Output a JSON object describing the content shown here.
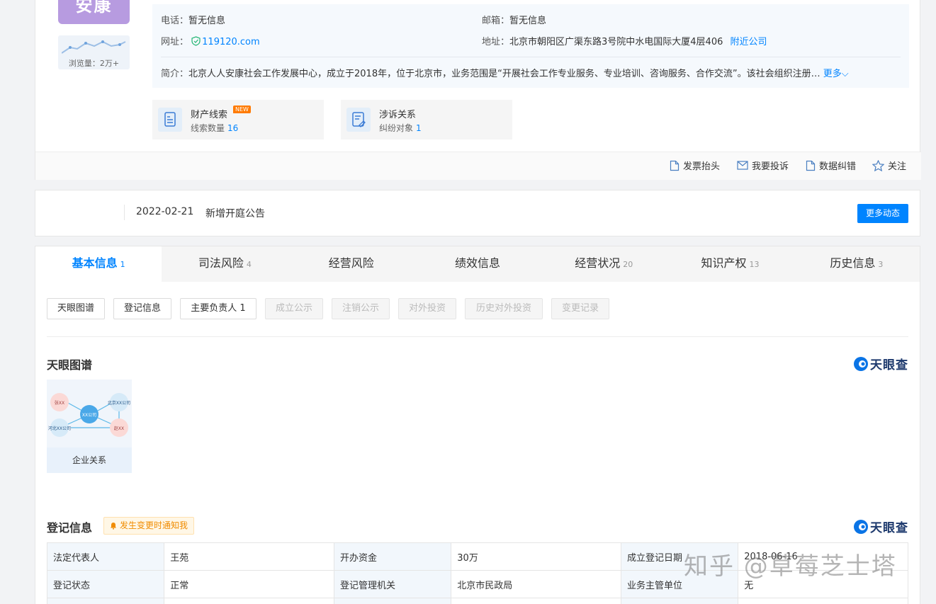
{
  "company": {
    "logo_text": "安康",
    "views_label": "浏览量：2万+"
  },
  "contact": {
    "phone_label": "电话：",
    "phone_value": "暂无信息",
    "email_label": "邮箱：",
    "email_value": "暂无信息",
    "website_label": "网址：",
    "website_value": "119120.com",
    "address_label": "地址：",
    "address_value": "北京市朝阳区广渠东路3号院中水电国际大厦4层406",
    "nearby_link": "附近公司",
    "intro_label": "简介：",
    "intro_value": "北京人人安康社会工作发展中心，成立于2018年，位于北京市，业务范围是“开展社会工作专业服务、专业培训、咨询服务、合作交流”。该社会组织注册…",
    "more_link": "更多"
  },
  "clues": [
    {
      "title": "财产线索",
      "badge": "NEW",
      "sub_label": "线索数量",
      "count": "16"
    },
    {
      "title": "涉诉关系",
      "sub_label": "纠纷对象",
      "count": "1"
    }
  ],
  "actions": {
    "invoice": "发票抬头",
    "complain": "我要投诉",
    "correct": "数据纠错",
    "follow": "关注"
  },
  "news": {
    "date": "2022-02-21",
    "text": "新增开庭公告",
    "more_button": "更多动态"
  },
  "tabs": [
    {
      "label": "基本信息",
      "count": "1"
    },
    {
      "label": "司法风险",
      "count": "4"
    },
    {
      "label": "经营风险",
      "count": ""
    },
    {
      "label": "绩效信息",
      "count": ""
    },
    {
      "label": "经营状况",
      "count": "20"
    },
    {
      "label": "知识产权",
      "count": "13"
    },
    {
      "label": "历史信息",
      "count": "3"
    }
  ],
  "chips": [
    {
      "label": "天眼图谱",
      "enabled": true
    },
    {
      "label": "登记信息",
      "enabled": true
    },
    {
      "label": "主要负责人 1",
      "enabled": true
    },
    {
      "label": "成立公示",
      "enabled": false
    },
    {
      "label": "注销公示",
      "enabled": false
    },
    {
      "label": "对外投资",
      "enabled": false
    },
    {
      "label": "历史对外投资",
      "enabled": false
    },
    {
      "label": "变更记录",
      "enabled": false
    }
  ],
  "graph_section": {
    "title": "天眼图谱",
    "brand": "天眼查",
    "card_label": "企业关系",
    "nodes": {
      "center": "XX公司",
      "a": "张XX",
      "b": "北京XX公司",
      "c": "河北XX公司",
      "d": "赵XX"
    }
  },
  "registration": {
    "title": "登记信息",
    "notify": "发生变更时通知我",
    "brand": "天眼查",
    "rows": [
      [
        "法定代表人",
        "王苑",
        "开办资金",
        "30万",
        "成立登记日期",
        "2018-06-16"
      ],
      [
        "登记状态",
        "正常",
        "登记管理机关",
        "北京市民政局",
        "业务主管单位",
        "无"
      ]
    ]
  },
  "watermark": "知乎 @草莓芝士塔",
  "colors": {
    "accent": "#0084ff",
    "logo_bg": "#b79be0",
    "status_ok": "#00a05a",
    "new_badge": "#ff7a00"
  }
}
